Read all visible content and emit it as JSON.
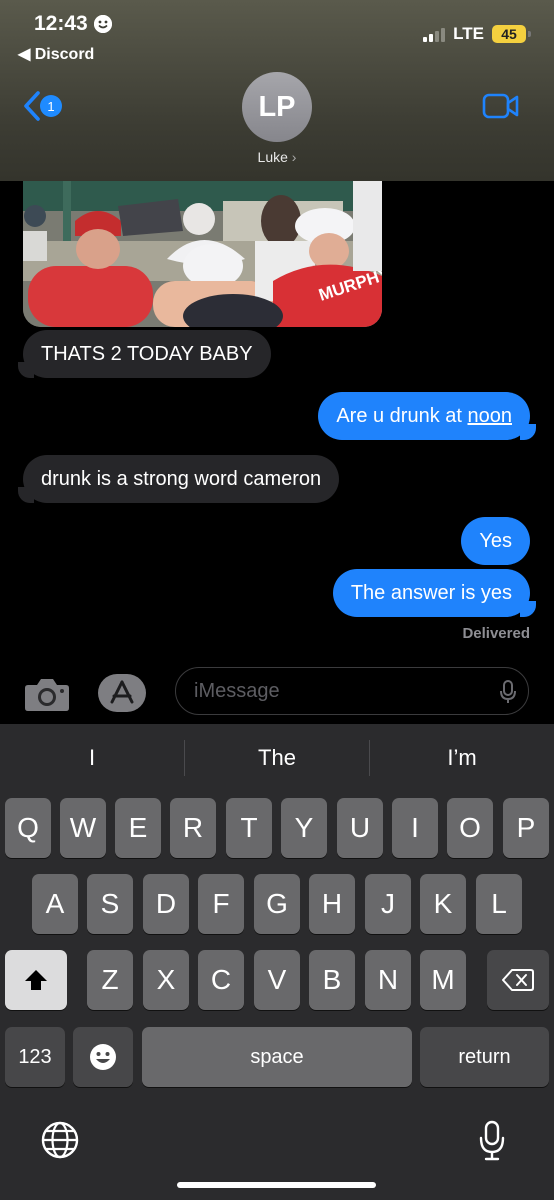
{
  "status_bar": {
    "time": "12:43",
    "back_app": "◀ Discord",
    "network": "LTE",
    "battery": "45"
  },
  "nav": {
    "unread_count": "1",
    "avatar_initials": "LP",
    "contact_name": "Luke"
  },
  "messages": {
    "photo_jersey_text": "MURPHY",
    "m1": "THATS 2 TODAY BABY",
    "m2_prefix": "Are u drunk at ",
    "m2_link": "noon",
    "m3": "drunk is a strong word cameron",
    "m4": "Yes",
    "m5": "The answer is yes",
    "delivered": "Delivered"
  },
  "input": {
    "placeholder": "iMessage"
  },
  "keyboard": {
    "suggestions": [
      "I",
      "The",
      "I’m"
    ],
    "row1": [
      "Q",
      "W",
      "E",
      "R",
      "T",
      "Y",
      "U",
      "I",
      "O",
      "P"
    ],
    "row2": [
      "A",
      "S",
      "D",
      "F",
      "G",
      "H",
      "J",
      "K",
      "L"
    ],
    "row3": [
      "Z",
      "X",
      "C",
      "V",
      "B",
      "N",
      "M"
    ],
    "numbers_label": "123",
    "space_label": "space",
    "return_label": "return"
  },
  "colors": {
    "accent": "#1f83fc",
    "incoming": "#262629",
    "battery": "#f4d03f"
  },
  "icons": [
    "camera-icon",
    "app-store-icon",
    "mic-icon",
    "video-call-icon",
    "emoji-icon",
    "globe-icon",
    "shift-icon",
    "delete-icon",
    "chevron-left-icon"
  ]
}
